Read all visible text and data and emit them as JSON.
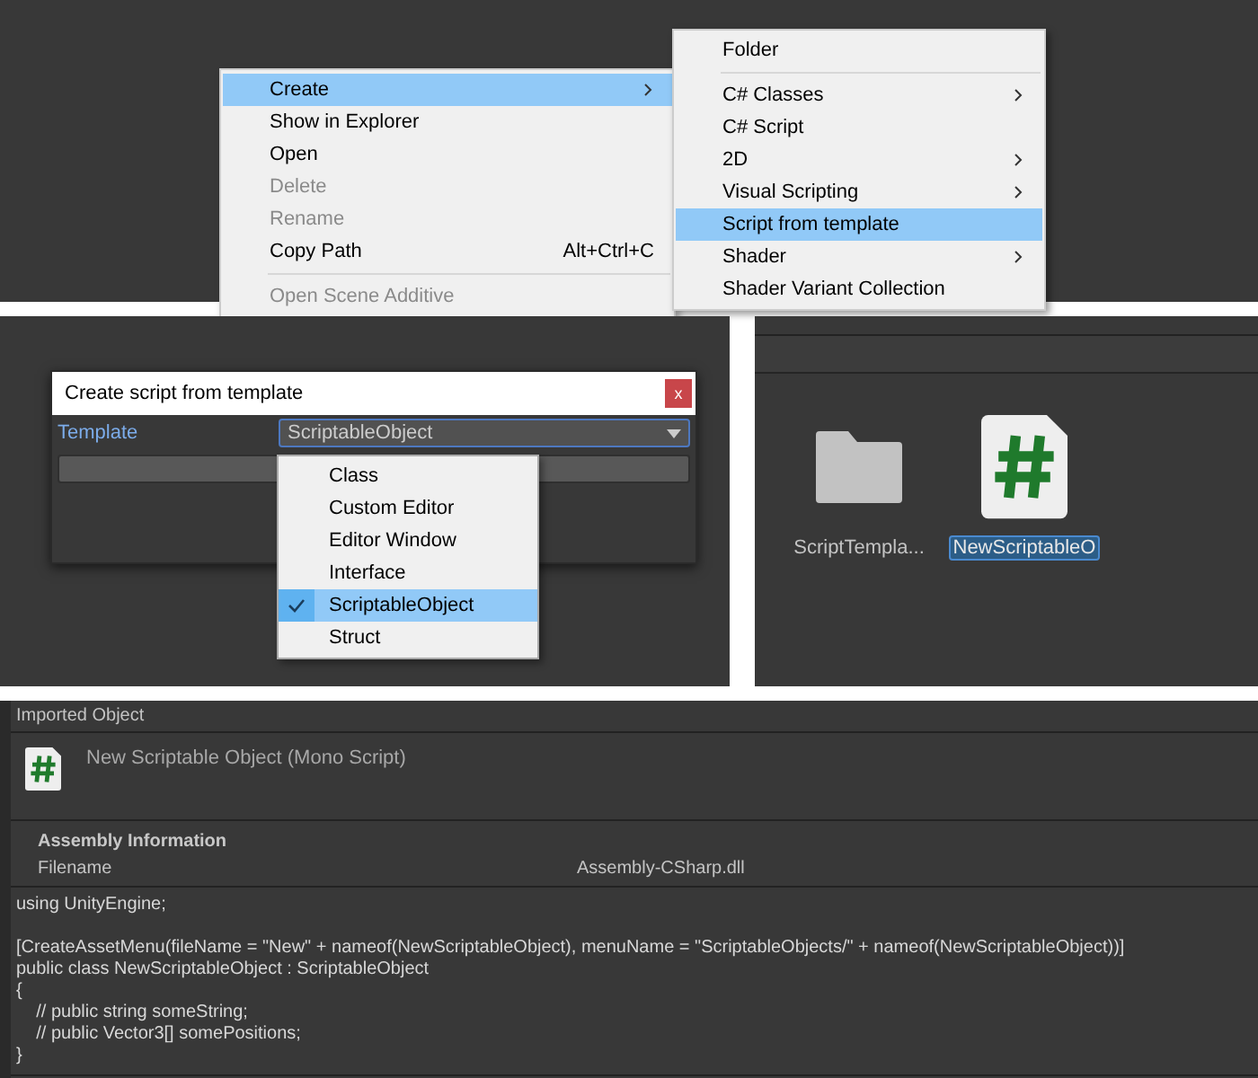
{
  "context_menu": {
    "items": [
      {
        "kind": "item",
        "label": "Create",
        "submenu": true,
        "selected": true,
        "disabled": false
      },
      {
        "kind": "item",
        "label": "Show in Explorer",
        "submenu": false,
        "selected": false,
        "disabled": false
      },
      {
        "kind": "item",
        "label": "Open",
        "submenu": false,
        "selected": false,
        "disabled": false
      },
      {
        "kind": "item",
        "label": "Delete",
        "submenu": false,
        "selected": false,
        "disabled": true
      },
      {
        "kind": "item",
        "label": "Rename",
        "submenu": false,
        "selected": false,
        "disabled": true
      },
      {
        "kind": "item",
        "label": "Copy Path",
        "shortcut": "Alt+Ctrl+C",
        "submenu": false,
        "selected": false,
        "disabled": false
      },
      {
        "kind": "separator"
      },
      {
        "kind": "item",
        "label": "Open Scene Additive",
        "submenu": false,
        "selected": false,
        "disabled": true
      }
    ]
  },
  "submenu": {
    "items": [
      {
        "kind": "item",
        "label": "Folder",
        "submenu": false,
        "selected": false
      },
      {
        "kind": "separator"
      },
      {
        "kind": "item",
        "label": "C# Classes",
        "submenu": true,
        "selected": false
      },
      {
        "kind": "item",
        "label": "C# Script",
        "submenu": false,
        "selected": false
      },
      {
        "kind": "item",
        "label": "2D",
        "submenu": true,
        "selected": false
      },
      {
        "kind": "item",
        "label": "Visual Scripting",
        "submenu": true,
        "selected": false
      },
      {
        "kind": "item",
        "label": "Script from template",
        "submenu": false,
        "selected": true
      },
      {
        "kind": "item",
        "label": "Shader",
        "submenu": true,
        "selected": false
      },
      {
        "kind": "item",
        "label": "Shader Variant Collection",
        "submenu": false,
        "selected": false
      }
    ]
  },
  "dialog": {
    "title": "Create script from template",
    "close": "x",
    "field_label": "Template",
    "dropdown_value": "ScriptableObject",
    "options": [
      {
        "label": "Class",
        "selected": false
      },
      {
        "label": "Custom Editor",
        "selected": false
      },
      {
        "label": "Editor Window",
        "selected": false
      },
      {
        "label": "Interface",
        "selected": false
      },
      {
        "label": "ScriptableObject",
        "selected": true
      },
      {
        "label": "Struct",
        "selected": false
      }
    ]
  },
  "project": {
    "assets": [
      {
        "kind": "folder",
        "name": "ScriptTempla...",
        "selected": false
      },
      {
        "kind": "script",
        "name": "NewScriptableO",
        "selected": true
      }
    ]
  },
  "inspector": {
    "header": "Imported Object",
    "title": "New Scriptable Object (Mono Script)",
    "section": "Assembly Information",
    "rows": [
      {
        "label": "Filename",
        "value": "Assembly-CSharp.dll"
      }
    ],
    "code": "using UnityEngine;\n\n[CreateAssetMenu(fileName = \"New\" + nameof(NewScriptableObject), menuName = \"ScriptableObjects/\" + nameof(NewScriptableObject))]\npublic class NewScriptableObject : ScriptableObject\n{\n    // public string someString;\n    // public Vector3[] somePositions;\n}"
  }
}
